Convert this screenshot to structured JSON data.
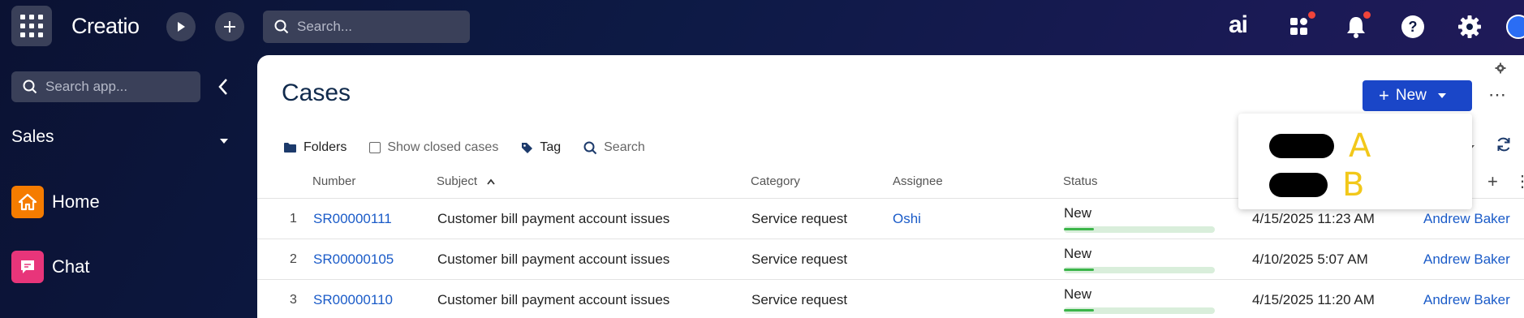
{
  "topbar": {
    "logo": "Creatio",
    "search_placeholder": "Search...",
    "ai_label": "ai"
  },
  "sidebar": {
    "search_placeholder": "Search app...",
    "workplace": "Sales",
    "items": [
      {
        "label": "Home",
        "color": "#f57c00"
      },
      {
        "label": "Chat",
        "color": "#e8357a"
      }
    ]
  },
  "main": {
    "title": "Cases",
    "new_button": "New",
    "dropdown_items": [
      "A",
      "B"
    ],
    "filters": {
      "folders": "Folders",
      "show_closed": "Show closed cases",
      "tag": "Tag",
      "search_placeholder": "Search"
    },
    "columns": [
      "Number",
      "Subject",
      "Category",
      "Assignee",
      "Status"
    ],
    "rows": [
      {
        "index": "1",
        "number": "SR00000111",
        "subject": "Customer bill payment account issues",
        "category": "Service request",
        "assignee": "Oshi",
        "status": "New",
        "status_progress": 0.2,
        "date": "4/15/2025 11:23 AM",
        "owner": "Andrew Baker"
      },
      {
        "index": "2",
        "number": "SR00000105",
        "subject": "Customer bill payment account issues",
        "category": "Service request",
        "assignee": "",
        "status": "New",
        "status_progress": 0.2,
        "date": "4/10/2025 5:07 AM",
        "owner": "Andrew Baker"
      },
      {
        "index": "3",
        "number": "SR00000110",
        "subject": "Customer bill payment account issues",
        "category": "Service request",
        "assignee": "",
        "status": "New",
        "status_progress": 0.2,
        "date": "4/15/2025 11:20 AM",
        "owner": "Andrew Baker"
      }
    ]
  },
  "colors": {
    "accent": "#1a46c8",
    "link": "#1a5bc8",
    "status_fill": "#3bb54a"
  }
}
